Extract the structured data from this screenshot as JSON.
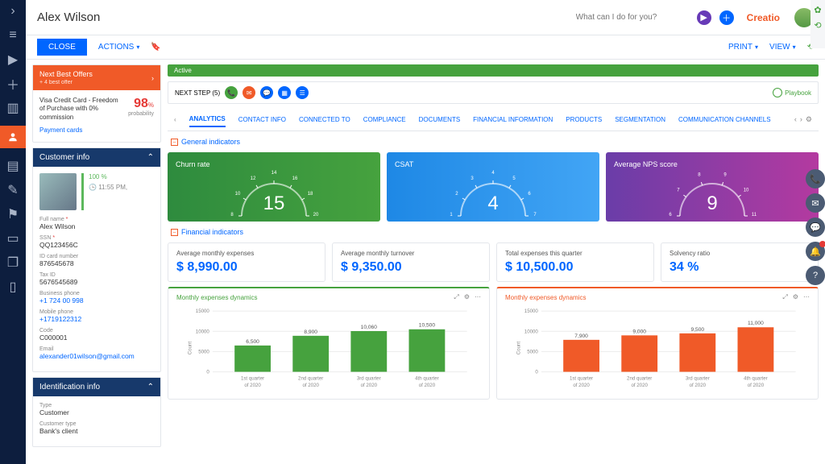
{
  "header": {
    "title": "Alex Wilson",
    "search_placeholder": "What can I do for you?",
    "brand": "Creatio"
  },
  "toolbar": {
    "close": "CLOSE",
    "actions": "ACTIONS",
    "print": "PRINT",
    "view": "VIEW"
  },
  "offer": {
    "head": "Next Best Offers",
    "sub": "+ 4 best offer",
    "text": "Visa Credit Card - Freedom of Purchase with 0% commission",
    "link": "Payment cards",
    "pct": "98",
    "pct_unit": "%",
    "prob_label": "probability"
  },
  "panels": {
    "customer": "Customer info",
    "identification": "Identification info"
  },
  "customer": {
    "complete": "100 %",
    "time_icon": "🕒",
    "time": "11:55 PM,",
    "fields": [
      {
        "label": "Full name",
        "value": "Alex Wilson",
        "req": true
      },
      {
        "label": "SSN",
        "value": "QQ123456C",
        "req": true
      },
      {
        "label": "ID card number",
        "value": "876545678"
      },
      {
        "label": "Tax ID",
        "value": "5676545689"
      },
      {
        "label": "Business phone",
        "value": "+1 724 00 998",
        "link": true
      },
      {
        "label": "Mobile phone",
        "value": "+1719122312",
        "link": true
      },
      {
        "label": "Code",
        "value": "C000001"
      },
      {
        "label": "Email",
        "value": "alexander01wilson@gmail.com",
        "link": true
      }
    ]
  },
  "identification": {
    "fields": [
      {
        "label": "Type",
        "value": "Customer"
      },
      {
        "label": "Customer type",
        "value": "Bank's client"
      }
    ]
  },
  "status": "Active",
  "nextstep": {
    "label": "NEXT STEP (5)",
    "playbook": "Playbook"
  },
  "tabs": [
    "ANALYTICS",
    "CONTACT INFO",
    "CONNECTED TO",
    "COMPLIANCE",
    "DOCUMENTS",
    "FINANCIAL INFORMATION",
    "PRODUCTS",
    "SEGMENTATION",
    "COMMUNICATION CHANNELS"
  ],
  "sections": {
    "general": "General indicators",
    "financial": "Financial indicators"
  },
  "gauges": [
    {
      "title": "Churn rate",
      "value": "15",
      "ticks": [
        "8",
        "10",
        "12",
        "14",
        "16",
        "18",
        "20"
      ],
      "cls": "green"
    },
    {
      "title": "CSAT",
      "value": "4",
      "ticks": [
        "1",
        "2",
        "3",
        "4",
        "5",
        "6",
        "7"
      ],
      "cls": "blue"
    },
    {
      "title": "Average NPS score",
      "value": "9",
      "ticks": [
        "6",
        "7",
        "8",
        "9",
        "10",
        "11"
      ],
      "cls": "purple"
    }
  ],
  "kpis": [
    {
      "title": "Average monthly expenses",
      "value": "$ 8,990.00"
    },
    {
      "title": "Average monthly turnover",
      "value": "$ 9,350.00"
    },
    {
      "title": "Total expenses this quarter",
      "value": "$ 10,500.00"
    },
    {
      "title": "Solvency ratio",
      "value": "34 %"
    }
  ],
  "chart_data": [
    {
      "type": "bar",
      "title": "Monthly expenses dynamics",
      "color": "#46a23e",
      "categories": [
        "1st quarter of 2020",
        "2nd quarter of 2020",
        "3rd quarter of 2020",
        "4th quarter of 2020"
      ],
      "values": [
        6500,
        8900,
        10060,
        10500
      ],
      "ylabel": "Count",
      "yticks": [
        0,
        5000,
        10000,
        15000
      ],
      "ylim": [
        0,
        15000
      ]
    },
    {
      "type": "bar",
      "title": "Monthly expenses dynamics",
      "color": "#f05a28",
      "categories": [
        "1st quarter of 2020",
        "2nd quarter of 2020",
        "3rd quarter of 2020",
        "4th quarter of 2020"
      ],
      "values": [
        7900,
        9000,
        9500,
        11000
      ],
      "ylabel": "Count",
      "yticks": [
        0,
        5000,
        10000,
        15000
      ],
      "ylim": [
        0,
        15000
      ]
    }
  ]
}
